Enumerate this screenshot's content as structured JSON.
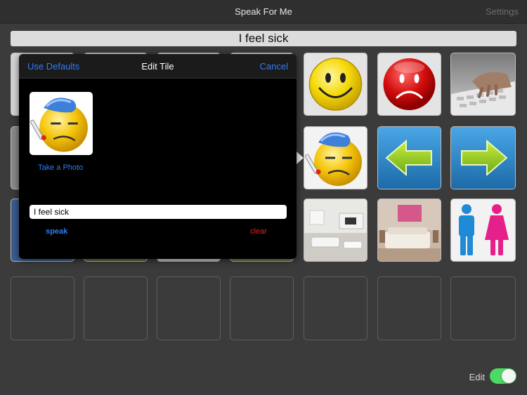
{
  "app": {
    "title": "Speak For Me",
    "settings_label": "Settings"
  },
  "phrase_bar": {
    "text": "I feel sick"
  },
  "grid": {
    "row1": [
      "smiley-face",
      "frown-face",
      "typing-keyboard"
    ],
    "row2": [
      "sick-face",
      "left-arrow",
      "right-arrow"
    ],
    "row3": [
      "living-room",
      "bedroom",
      "restroom"
    ]
  },
  "popover": {
    "title": "Edit Tile",
    "use_defaults_label": "Use Defaults",
    "cancel_label": "Cancel",
    "take_photo_label": "Take a Photo",
    "text_value": "I feel sick",
    "speak_label": "speak",
    "clear_label": "clear"
  },
  "footer": {
    "edit_label": "Edit",
    "edit_toggle_on": true
  },
  "colors": {
    "accent": "#2f7cf6",
    "clear": "#e3241b",
    "toggle_on": "#4cd964",
    "background": "#3b3b3b"
  }
}
